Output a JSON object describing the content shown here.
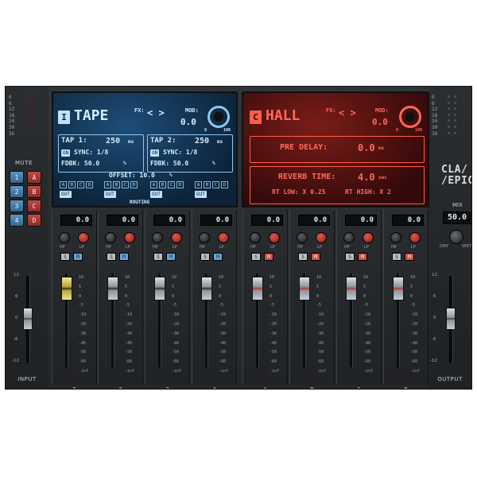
{
  "left": {
    "meter_scale": [
      "0",
      "6",
      "12",
      "18",
      "24",
      "30",
      "36"
    ],
    "mute_label": "MUTE",
    "mute_buttons": [
      [
        "1",
        "A"
      ],
      [
        "2",
        "B"
      ],
      [
        "3",
        "C"
      ],
      [
        "4",
        "D"
      ]
    ],
    "fader_scale": [
      "12",
      "6",
      "0",
      "-6",
      "-12"
    ],
    "label": "INPUT"
  },
  "right": {
    "meter_scale": [
      "0",
      "6",
      "12",
      "18",
      "24",
      "30",
      "36"
    ],
    "logo_line1": "CLA/",
    "logo_line2": "/EPIC",
    "mix_label": "MIX",
    "mix_value": "50.0",
    "dry_label": "DRY",
    "wet_label": "WET",
    "fader_scale": [
      "12",
      "6",
      "0",
      "-6",
      "-12"
    ],
    "label": "OUTPUT"
  },
  "blue_screen": {
    "badge": "I",
    "title": "TAPE",
    "fx_label": "FX:",
    "arrows": "< >",
    "mod_label": "MOD:",
    "mod_value": "0.0",
    "mod_min": "0",
    "mod_max": "100",
    "tap1_label": "TAP 1:",
    "tap1_value": "250",
    "tap1_unit": "ms",
    "tap2_label": "TAP 2:",
    "tap2_value": "250",
    "tap2_unit": "ms",
    "sync_on": "ON",
    "sync1": "SYNC: 1/8",
    "sync2": "SYNC: 1/8",
    "fdbk1": "FDBK: 50.0",
    "fdbk2": "FDBK: 50.0",
    "pct": "%",
    "offset": "OFFSET: 10.0",
    "routing": "ROUTING",
    "route_letters": [
      "A",
      "B",
      "C",
      "D"
    ],
    "out_label": "OUT"
  },
  "red_screen": {
    "badge": "C",
    "title": "HALL",
    "fx_label": "FX:",
    "arrows": "< >",
    "mod_label": "MOD:",
    "mod_value": "0.0",
    "mod_min": "0",
    "mod_max": "100",
    "predelay_label": "PRE DELAY:",
    "predelay_value": "0.0",
    "predelay_unit": "ms",
    "reverb_label": "REVERB TIME:",
    "reverb_value": "4.0",
    "reverb_unit": "sec",
    "rt_low": "RT LOW: X 0.25",
    "rt_high": "RT HIGH: X 2"
  },
  "channels": [
    {
      "name": "I",
      "value": "0.0",
      "mute": "blue"
    },
    {
      "name": "2",
      "value": "0.0",
      "mute": "blue"
    },
    {
      "name": "3",
      "value": "0.0",
      "mute": "blue"
    },
    {
      "name": "4",
      "value": "0.0",
      "mute": "blue"
    },
    {
      "name": "A",
      "value": "0.0",
      "mute": "red"
    },
    {
      "name": "B",
      "value": "0.0",
      "mute": "red"
    },
    {
      "name": "C",
      "value": "0.0",
      "mute": "red"
    },
    {
      "name": "D",
      "value": "0.0",
      "mute": "red"
    }
  ],
  "channel_labels": {
    "hp": "HP",
    "lp": "LP",
    "solo": "S",
    "mute": "M"
  },
  "strip_scale": [
    "10",
    "5",
    "0",
    "-5",
    "-10",
    "-20",
    "-30",
    "-40",
    "-50",
    "-60",
    "-inf"
  ],
  "colors": {
    "accent_blue": "#4f8fc6",
    "accent_red": "#d24a42",
    "panel": "#2a2d30"
  }
}
